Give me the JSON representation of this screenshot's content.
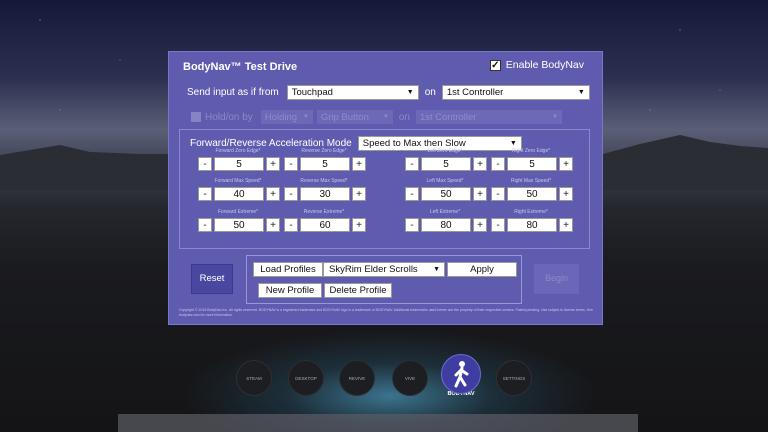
{
  "window": {
    "title": "BodyNav™ Test Drive",
    "enable_label": "Enable BodyNav",
    "enable_checked": "✓"
  },
  "input": {
    "label": "Send input as if from",
    "source": "Touchpad",
    "on_label": "on",
    "controller": "1st Controller"
  },
  "hold": {
    "label": "Hold/on by",
    "mode": "Holding",
    "button": "Grip Button",
    "on_label": "on",
    "controller": "1st Controller"
  },
  "accel": {
    "label": "Forward/Reverse Acceleration Mode",
    "value": "Speed to Max then Slow"
  },
  "steppers": [
    {
      "label": "Forward Zero Edge*",
      "value": "5"
    },
    {
      "label": "Reverse Zero Edge*",
      "value": "5"
    },
    {
      "label": "Left Zero Edge*",
      "value": "5"
    },
    {
      "label": "Right Zero Edge*",
      "value": "5"
    },
    {
      "label": "Forward Max Speed*",
      "value": "40"
    },
    {
      "label": "Reverse Max Speed*",
      "value": "30"
    },
    {
      "label": "Left Max Speed*",
      "value": "50"
    },
    {
      "label": "Right Max Speed*",
      "value": "50"
    },
    {
      "label": "Forward Extreme*",
      "value": "50"
    },
    {
      "label": "Reverse Extreme*",
      "value": "60"
    },
    {
      "label": "Left Extreme*",
      "value": "80"
    },
    {
      "label": "Right Extreme*",
      "value": "80"
    }
  ],
  "minus": "-",
  "plus": "+",
  "buttons": {
    "reset": "Reset",
    "load_profiles": "Load Profiles",
    "profile": "SkyRim Elder Scrolls",
    "apply": "Apply",
    "new_profile": "New Profile",
    "delete_profile": "Delete Profile",
    "begin": "Begin"
  },
  "copyright": "Copyright © 2016 BodyNav Inc. All rights reserved. BODYNAV is a registered trademark and BODYNAV logo is a trademark of BODYNAV. Additional trademarks used herein are the property of their respective owners. Patent pending. Use subject to license terms. See bodynav.com for more information.",
  "dock": [
    {
      "label": "STEAM"
    },
    {
      "label": "DESKTOP"
    },
    {
      "label": "REVIVE"
    },
    {
      "label": "VIVE"
    },
    {
      "label": "BODYNAV"
    },
    {
      "label": "SETTINGS"
    }
  ],
  "colors": {
    "panel": "#5f5cb0",
    "accent": "#4a47a0"
  }
}
